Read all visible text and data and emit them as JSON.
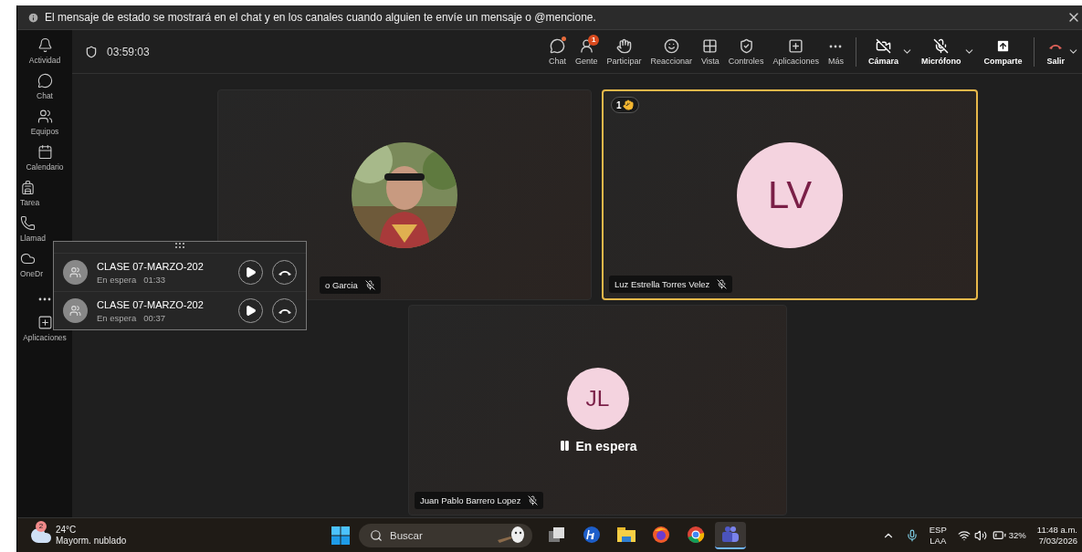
{
  "banner": {
    "text": "El mensaje de estado se mostrará en el chat y en los canales cuando alguien te envíe un mensaje o @mencione."
  },
  "rail": [
    {
      "label": "Actividad",
      "kind": "full"
    },
    {
      "label": "Chat",
      "kind": "full"
    },
    {
      "label": "Equipos",
      "kind": "full"
    },
    {
      "label": "Calendario",
      "kind": "full"
    },
    {
      "label": "Tarea",
      "kind": "cut"
    },
    {
      "label": "Llamad",
      "kind": "cut"
    },
    {
      "label": "OneDr",
      "kind": "cut"
    },
    {
      "kind": "more"
    },
    {
      "label": "Aplicaciones",
      "kind": "full"
    }
  ],
  "toolbar": {
    "timer": "03:59:03",
    "items": [
      {
        "label": "Chat",
        "kind": "plain",
        "dot": true
      },
      {
        "label": "Gente",
        "kind": "plain",
        "badge": "1"
      },
      {
        "label": "Participar",
        "kind": "plain"
      },
      {
        "label": "Reaccionar",
        "kind": "plain"
      },
      {
        "label": "Vista",
        "kind": "plain"
      },
      {
        "label": "Controles",
        "kind": "plain"
      },
      {
        "label": "Aplicaciones",
        "kind": "plain"
      },
      {
        "label": "Más",
        "kind": "plain"
      },
      {
        "label": "Cámara",
        "kind": "device",
        "off": true
      },
      {
        "label": "Micrófono",
        "kind": "device",
        "off": true
      },
      {
        "label": "Comparte",
        "kind": "share"
      },
      {
        "label": "Salir",
        "kind": "leave"
      }
    ]
  },
  "tiles": [
    {
      "name": "o Garcia",
      "muted": true,
      "hand": false,
      "selected": false
    },
    {
      "name": "Luz Estrella Torres Velez",
      "kind": "initials",
      "initials": "LV",
      "muted": true,
      "hand": true,
      "hand_count": "1",
      "selected": true
    },
    {
      "name": "Juan Pablo Barrero Lopez",
      "kind": "initials",
      "initials": "JL",
      "muted": true,
      "hand": false,
      "selected": false,
      "status": "En espera"
    }
  ],
  "held_calls": [
    {
      "title": "CLASE 07-MARZO-202",
      "status": "En espera",
      "time": "01:33"
    },
    {
      "title": "CLASE 07-MARZO-202",
      "status": "En espera",
      "time": "00:37"
    }
  ],
  "taskbar": {
    "weather": {
      "badge": "2",
      "temp": "24°C",
      "text": "Mayorm. nublado"
    },
    "search": {
      "placeholder": "Buscar"
    },
    "apps": [
      {
        "selected": false
      },
      {
        "selected": false
      },
      {
        "selected": false
      },
      {
        "selected": false
      },
      {
        "selected": false
      },
      {
        "selected": true
      }
    ],
    "language": "ESP",
    "layout": "LAA",
    "battery": "32%",
    "time": "11:48 a.m.",
    "date": "7/03/2026"
  }
}
